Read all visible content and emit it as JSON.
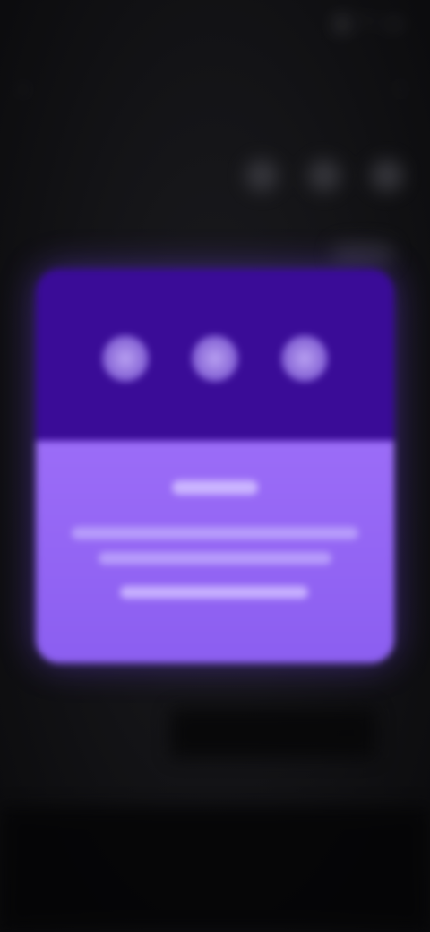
{
  "status_bar": {
    "time": "",
    "icons": [
      "signal-icon",
      "wifi-icon",
      "battery-icon"
    ]
  },
  "top_bar": {
    "title": ""
  },
  "modal": {
    "title": "",
    "lines": [
      "",
      "",
      ""
    ],
    "caption": "",
    "colors": {
      "top": "#3a0c97",
      "bottom": "#9b6cf7",
      "dot": "#b9a2f2"
    },
    "dots": [
      "dot-1",
      "dot-2",
      "dot-3"
    ]
  }
}
